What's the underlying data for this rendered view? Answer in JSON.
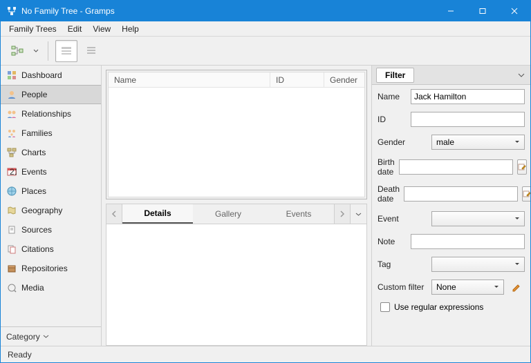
{
  "window": {
    "title": "No Family Tree - Gramps"
  },
  "menu": {
    "family_trees": "Family Trees",
    "edit": "Edit",
    "view": "View",
    "help": "Help"
  },
  "sidebar": {
    "items": [
      {
        "label": "Dashboard"
      },
      {
        "label": "People"
      },
      {
        "label": "Relationships"
      },
      {
        "label": "Families"
      },
      {
        "label": "Charts"
      },
      {
        "label": "Events"
      },
      {
        "label": "Places"
      },
      {
        "label": "Geography"
      },
      {
        "label": "Sources"
      },
      {
        "label": "Citations"
      },
      {
        "label": "Repositories"
      },
      {
        "label": "Media"
      }
    ],
    "category": "Category"
  },
  "grid": {
    "col_name": "Name",
    "col_id": "ID",
    "col_gender": "Gender"
  },
  "tabs": {
    "details": "Details",
    "gallery": "Gallery",
    "events": "Events"
  },
  "filter": {
    "header": "Filter",
    "name_label": "Name",
    "name_value": "Jack Hamilton",
    "id_label": "ID",
    "id_value": "",
    "gender_label": "Gender",
    "gender_value": "male",
    "birth_label": "Birth date",
    "birth_value": "",
    "death_label": "Death date",
    "death_value": "",
    "event_label": "Event",
    "event_value": "",
    "note_label": "Note",
    "note_value": "",
    "tag_label": "Tag",
    "tag_value": "",
    "custom_label": "Custom filter",
    "custom_value": "None",
    "regex_label": "Use regular expressions"
  },
  "status": {
    "text": "Ready"
  }
}
